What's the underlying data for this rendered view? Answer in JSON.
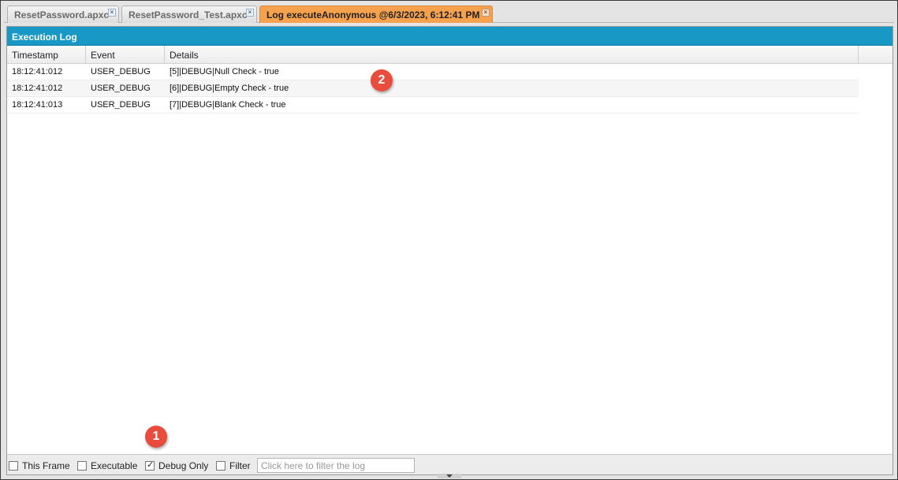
{
  "tabs": [
    {
      "label": "ResetPassword.apxc",
      "close": "×",
      "active": false
    },
    {
      "label": "ResetPassword_Test.apxc",
      "close": "×",
      "active": false
    },
    {
      "label": "Log executeAnonymous @6/3/2023, 6:12:41 PM",
      "close": "×",
      "active": true
    }
  ],
  "panel": {
    "title": "Execution Log",
    "columns": [
      "Timestamp",
      "Event",
      "Details"
    ]
  },
  "rows": [
    {
      "timestamp": "18:12:41:012",
      "event": "USER_DEBUG",
      "details": "[5]|DEBUG|Null Check - true"
    },
    {
      "timestamp": "18:12:41:012",
      "event": "USER_DEBUG",
      "details": "[6]|DEBUG|Empty Check - true"
    },
    {
      "timestamp": "18:12:41:013",
      "event": "USER_DEBUG",
      "details": "[7]|DEBUG|Blank Check - true"
    }
  ],
  "footer": {
    "this_frame": {
      "label": "This Frame",
      "checked": false
    },
    "executable": {
      "label": "Executable",
      "checked": false
    },
    "debug_only": {
      "label": "Debug Only",
      "checked": true
    },
    "filter": {
      "label": "Filter",
      "checked": false
    },
    "filter_placeholder": "Click here to filter the log"
  },
  "markers": {
    "one": "1",
    "two": "2"
  },
  "colors": {
    "header": "#1798c5",
    "active_tab": "#f5a14d",
    "marker": "#e94b3c"
  }
}
